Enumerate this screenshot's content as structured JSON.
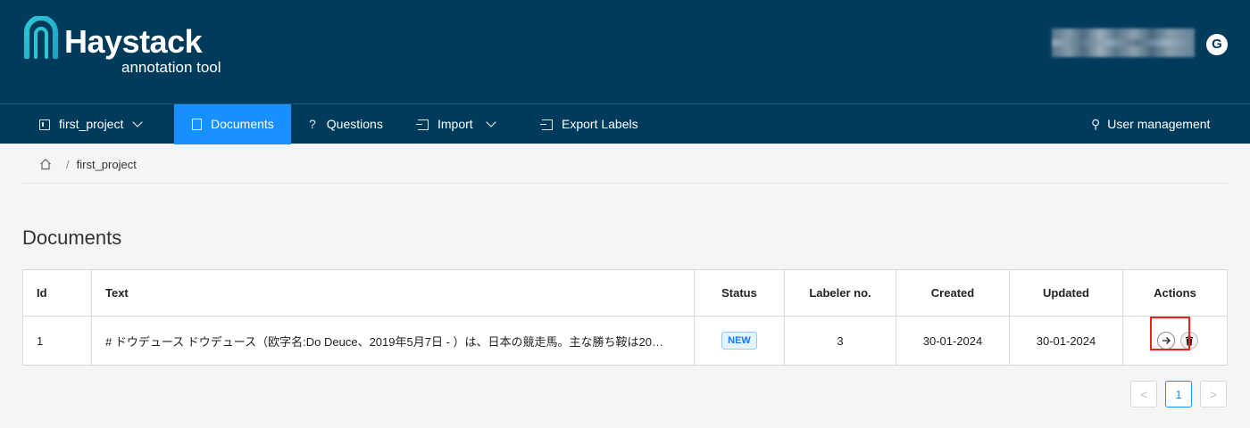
{
  "brand": {
    "title": "Haystack",
    "subtitle": "annotation tool",
    "avatar_letter": "G"
  },
  "nav": {
    "project_label": "first_project",
    "documents_label": "Documents",
    "questions_label": "Questions",
    "import_label": "Import",
    "export_label": "Export Labels",
    "user_mgmt_label": "User management",
    "active_color": "#1890ff",
    "bar_color": "#003b5c"
  },
  "breadcrumb": {
    "project": "first_project",
    "separator": "/"
  },
  "page": {
    "title": "Documents"
  },
  "table": {
    "columns": [
      "Id",
      "Text",
      "Status",
      "Labeler no.",
      "Created",
      "Updated",
      "Actions"
    ],
    "rows": [
      {
        "id": "1",
        "text": "# ドウデュース ドウデュース（欧字名:Do Deuce、2019年5月7日 - ）は、日本の競走馬。主な勝ち鞍は20…",
        "status": "NEW",
        "labelers": "3",
        "created": "30-01-2024",
        "updated": "30-01-2024"
      }
    ]
  },
  "pagination": {
    "prev": "<",
    "current": "1",
    "next": ">"
  },
  "icons": {
    "project": "board-icon",
    "documents": "document-icon",
    "questions": "question-icon",
    "import": "import-icon",
    "export": "export-icon",
    "users": "users-icon",
    "home": "home-icon",
    "open": "arrow-right-icon",
    "delete": "trash-icon"
  },
  "highlight_color": "#e8251d"
}
